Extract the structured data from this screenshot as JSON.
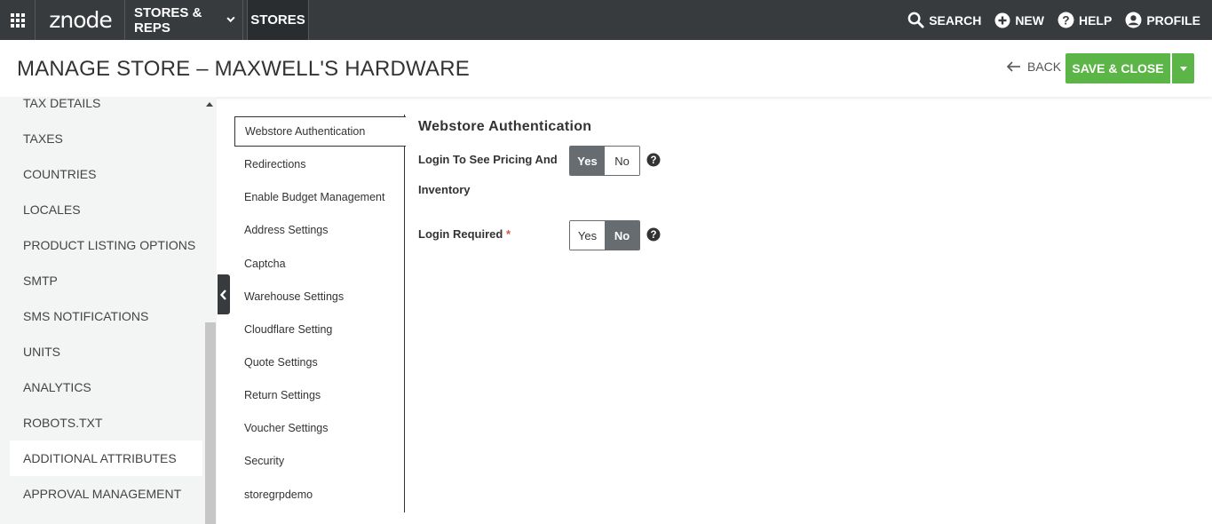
{
  "topbar": {
    "logo": "znode",
    "nav": [
      {
        "label": "STORES & REPS"
      },
      {
        "label": "STORES"
      }
    ],
    "right": [
      {
        "label": "SEARCH",
        "icon": "search-icon"
      },
      {
        "label": "NEW",
        "icon": "plus-circle-icon"
      },
      {
        "label": "HELP",
        "icon": "question-circle-icon"
      },
      {
        "label": "PROFILE",
        "icon": "user-circle-icon"
      }
    ]
  },
  "header": {
    "title": "MANAGE STORE  –  MAXWELL'S HARDWARE",
    "back_label": "BACK",
    "save_label": "SAVE & CLOSE"
  },
  "sidebar": {
    "items": [
      {
        "label": "TAX DETAILS"
      },
      {
        "label": "TAXES"
      },
      {
        "label": "COUNTRIES"
      },
      {
        "label": "LOCALES"
      },
      {
        "label": "PRODUCT LISTING OPTIONS"
      },
      {
        "label": "SMTP"
      },
      {
        "label": "SMS NOTIFICATIONS"
      },
      {
        "label": "UNITS"
      },
      {
        "label": "ANALYTICS"
      },
      {
        "label": "ROBOTS.TXT"
      },
      {
        "label": "ADDITIONAL ATTRIBUTES",
        "active": true
      },
      {
        "label": "APPROVAL MANAGEMENT"
      }
    ]
  },
  "submenu": {
    "items": [
      {
        "label": "Webstore Authentication",
        "active": true
      },
      {
        "label": "Redirections"
      },
      {
        "label": "Enable Budget Management"
      },
      {
        "label": "Address Settings"
      },
      {
        "label": "Captcha"
      },
      {
        "label": "Warehouse Settings"
      },
      {
        "label": "Cloudflare Setting"
      },
      {
        "label": "Quote Settings"
      },
      {
        "label": "Return Settings"
      },
      {
        "label": "Voucher Settings"
      },
      {
        "label": "Security"
      },
      {
        "label": "storegrpdemo"
      }
    ]
  },
  "form": {
    "title": "Webstore Authentication",
    "fields": [
      {
        "label_line1": "Login To See Pricing And",
        "label_line2": "Inventory",
        "yes": "Yes",
        "no": "No",
        "selected": "Yes"
      },
      {
        "label": "Login Required",
        "required_mark": "*",
        "yes": "Yes",
        "no": "No",
        "selected": "No"
      }
    ]
  },
  "colors": {
    "topbar": "#373b3e",
    "accent_green": "#5cb547",
    "toggle_selected": "#666c70",
    "sidebar_bg": "#f3f4f4"
  }
}
